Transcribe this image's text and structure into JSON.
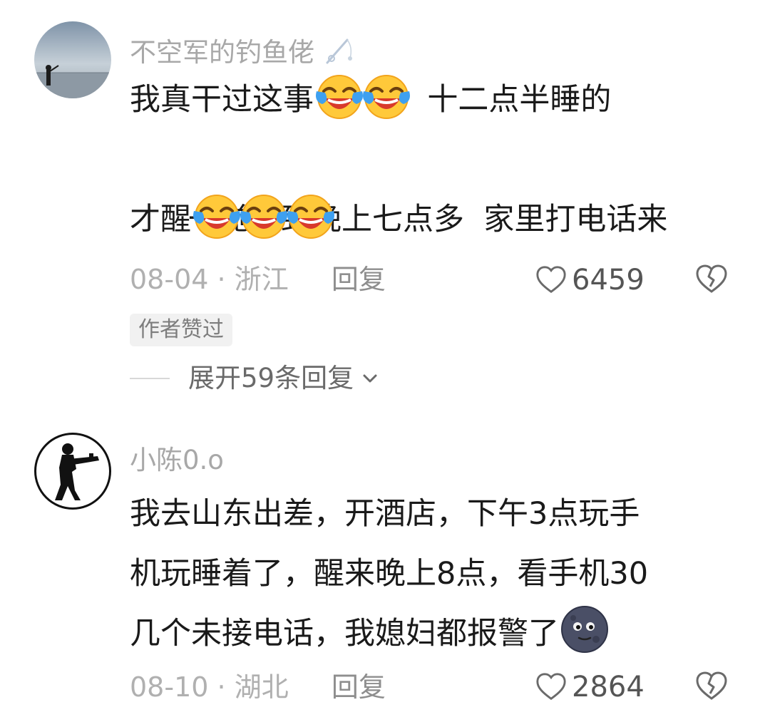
{
  "comments": [
    {
      "username": "不空军的钓鱼佬",
      "lines": [
        {
          "text": "我真干过这事",
          "emoji_after": 2,
          "rest": "  十二点半睡的"
        },
        {
          "text": "一觉睡到晚上七点多  家里打电话来"
        },
        {
          "text": "才醒",
          "emoji_after": 3
        }
      ],
      "emoji": "crying-laughing-emoji",
      "date": "08-04",
      "location": "浙江",
      "reply_label": "回复",
      "likes": "6459",
      "badge": "作者赞过",
      "expand_label": "展开59条回复"
    },
    {
      "username": "小陈0.o",
      "lines": [
        {
          "text": "我去山东出差，开酒店，下午3点玩手"
        },
        {
          "text": "机玩睡着了，醒来晚上8点，看手机30"
        },
        {
          "text": "几个未接电话，我媳妇都报警了",
          "emoji_after": 1
        }
      ],
      "emoji": "dark-moon-face-emoji",
      "date": "08-10",
      "location": "湖北",
      "reply_label": "回复",
      "likes": "2864"
    }
  ],
  "separator": "·",
  "icons": [
    "fishing-rod-icon",
    "heart-icon",
    "broken-heart-icon",
    "chevron-down-icon"
  ],
  "colors": {
    "username": "#a8a8a8",
    "meta": "#b0b0b0",
    "text": "#1a1a1a",
    "badge_bg": "#f1f1f1"
  }
}
